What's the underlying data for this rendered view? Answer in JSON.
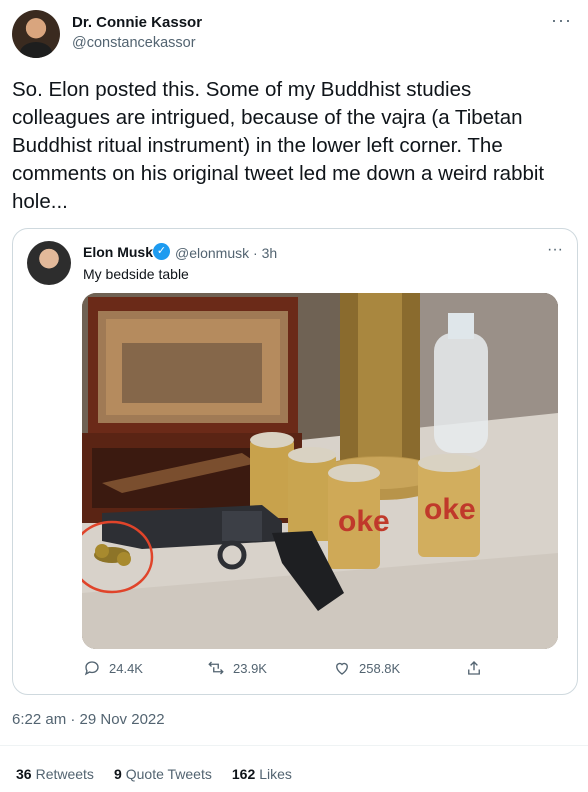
{
  "author": {
    "name": "Dr. Connie Kassor",
    "handle": "@constancekassor"
  },
  "tweet": {
    "text": "So. Elon posted this. Some of my Buddhist studies colleagues are intrigued, because of the vajra (a Tibetan Buddhist ritual instrument) in the lower left corner. The comments on his original tweet led me down a weird rabbit hole...",
    "timestamp": "6:22 am · 29 Nov 2022"
  },
  "quoted": {
    "name": "Elon Musk",
    "handle_time": "@elonmusk · 3h",
    "text": "My bedside table",
    "actions": {
      "replies": "24.4K",
      "retweets": "23.9K",
      "likes": "258.8K"
    }
  },
  "stats": {
    "retweets_count": "36",
    "retweets_label": "Retweets",
    "quotes_count": "9",
    "quotes_label": "Quote Tweets",
    "likes_count": "162",
    "likes_label": "Likes"
  },
  "icons": {
    "more": "more-horizontal-icon",
    "verified": "verified-badge-icon",
    "reply": "reply-icon",
    "retweet": "retweet-icon",
    "like": "heart-icon",
    "share": "share-icon"
  },
  "colors": {
    "text": "#0f1419",
    "muted": "#536471",
    "border": "#cfd9de",
    "verified": "#1d9bf0",
    "circle_annotation": "#e0442a"
  }
}
